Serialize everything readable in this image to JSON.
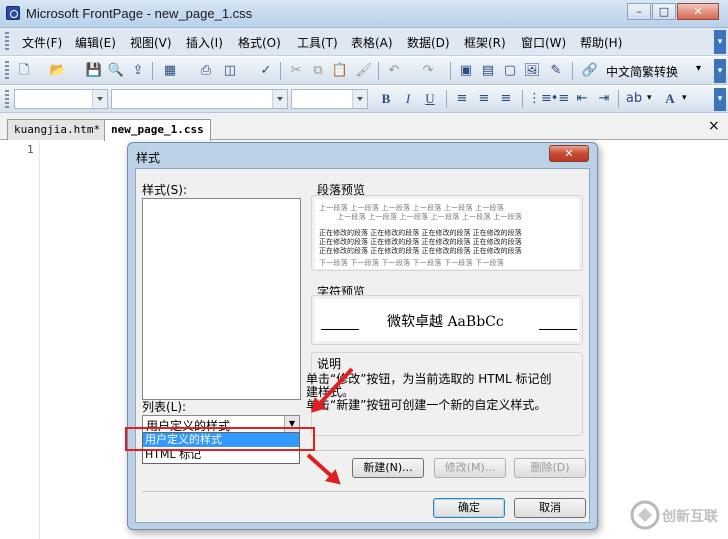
{
  "window": {
    "title": "Microsoft FrontPage - new_page_1.css"
  },
  "menu": [
    "文件(F)",
    "编辑(E)",
    "视图(V)",
    "插入(I)",
    "格式(O)",
    "工具(T)",
    "表格(A)",
    "数据(D)",
    "框架(R)",
    "窗口(W)",
    "帮助(H)"
  ],
  "toolbar": {
    "convert_label": "中文简繁转换"
  },
  "tabs": [
    "kuangjia.htm*",
    "new_page_1.css"
  ],
  "tabs_close": "×",
  "editor": {
    "line_number": "1"
  },
  "dialog": {
    "title": "样式",
    "close": "✕",
    "styles_label": "样式(S):",
    "para_preview_label": "段落预览",
    "para_prev_text": "上一段落 上一段落 上一段落 上一段落 上一段落 上一段落",
    "para_cur_text": "正在修改的段落 正在修改的段落 正在修改的段落 正在修改的段落",
    "para_next_text": "下一段落 下一段落 下一段落 下一段落 下一段落 下一段落",
    "char_preview_label": "字符预览",
    "char_preview_text": "微软卓越 AaBbCc",
    "desc_label": "说明",
    "desc_line1": "单击“修改”按钮，为当前选取的 HTML 标记创",
    "desc_line2": "建样式。",
    "desc_line3": "单击“新建”按钮可创建一个新的自定义样式。",
    "list_label": "列表(L):",
    "list_selected": "用户定义的样式",
    "list_options": [
      "用户定义的样式",
      "HTML 标记"
    ],
    "new_button": "新建(N)...",
    "modify_button": "修改(M)...",
    "delete_button": "删除(D)",
    "ok_button": "确定",
    "cancel_button": "取消"
  },
  "watermark": {
    "text": "创新互联"
  },
  "colors": {
    "annotation_red": "#e02020",
    "selection_blue": "#3399ff"
  }
}
